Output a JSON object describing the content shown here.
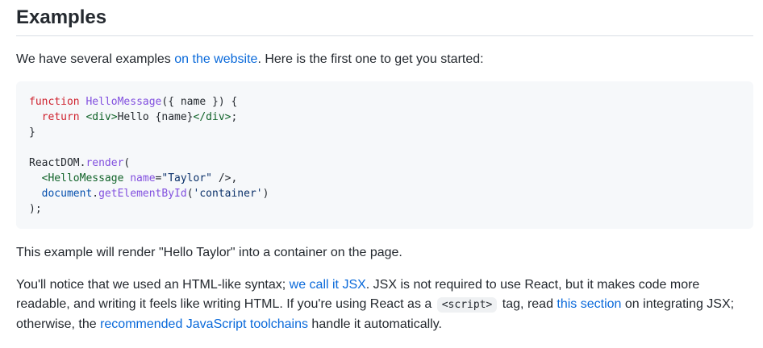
{
  "heading": "Examples",
  "intro": {
    "before": "We have several examples ",
    "link": "on the website",
    "after": ". Here is the first one to get you started:"
  },
  "code": {
    "l1_kw": "function",
    "l1_fn": "HelloMessage",
    "l1_rest": "({ name }) {",
    "l2_kw": "return",
    "l2_open": "<div>",
    "l2_mid": "Hello {name}",
    "l2_close": "</div>",
    "l2_semi": ";",
    "l3": "}",
    "l5_obj": "ReactDOM",
    "l5_dot": ".",
    "l5_fn": "render",
    "l5_paren": "(",
    "l6_tag": "<HelloMessage",
    "l6_attr": "name",
    "l6_eq": "=",
    "l6_str": "\"Taylor\"",
    "l6_close": " />,",
    "l7_obj": "document",
    "l7_dot": ".",
    "l7_fn": "getElementById",
    "l7_open": "(",
    "l7_str": "'container'",
    "l7_close": ")",
    "l8": ");"
  },
  "p2": "This example will render \"Hello Taylor\" into a container on the page.",
  "p3": {
    "t1": "You'll notice that we used an HTML-like syntax; ",
    "link1": "we call it JSX",
    "t2": ". JSX is not required to use React, but it makes code more readable, and writing it feels like writing HTML. If you're using React as a ",
    "code": "<script>",
    "t3": " tag, read ",
    "link2": "this section",
    "t4": " on integrating JSX; otherwise, the ",
    "link3": "recommended JavaScript toolchains",
    "t5": " handle it automatically."
  },
  "colors": {
    "link": "#0969da",
    "keyword": "#cf222e",
    "function": "#8250df",
    "tag": "#116329",
    "string": "#0a3069",
    "code_bg": "#f6f8fa"
  }
}
